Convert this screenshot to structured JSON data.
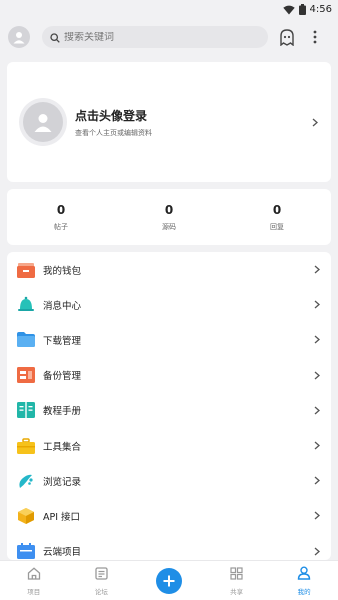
{
  "status": {
    "time": "4:56"
  },
  "search": {
    "placeholder": "搜索关键词"
  },
  "profile": {
    "title": "点击头像登录",
    "subtitle": "查看个人主页或编辑资料"
  },
  "stats": [
    {
      "value": "0",
      "label": "帖子"
    },
    {
      "value": "0",
      "label": "源码"
    },
    {
      "value": "0",
      "label": "回复"
    }
  ],
  "menu": [
    {
      "label": "我的钱包",
      "icon": "wallet-icon"
    },
    {
      "label": "消息中心",
      "icon": "bell-icon"
    },
    {
      "label": "下载管理",
      "icon": "folder-icon"
    },
    {
      "label": "备份管理",
      "icon": "backup-icon"
    },
    {
      "label": "教程手册",
      "icon": "book-icon"
    },
    {
      "label": "工具集合",
      "icon": "toolbox-icon"
    },
    {
      "label": "浏览记录",
      "icon": "footprint-icon"
    },
    {
      "label": "API 接口",
      "icon": "cube-icon"
    },
    {
      "label": "云端项目",
      "icon": "calendar-icon"
    }
  ],
  "nav": [
    {
      "label": "项目",
      "icon": "home-icon"
    },
    {
      "label": "论坛",
      "icon": "forum-icon"
    },
    {
      "label": "",
      "icon": "add-icon"
    },
    {
      "label": "共享",
      "icon": "grid-icon"
    },
    {
      "label": "我的",
      "icon": "user-icon"
    }
  ],
  "colors": {
    "accent": "#1f8ee6",
    "background": "#f1f1f3"
  }
}
